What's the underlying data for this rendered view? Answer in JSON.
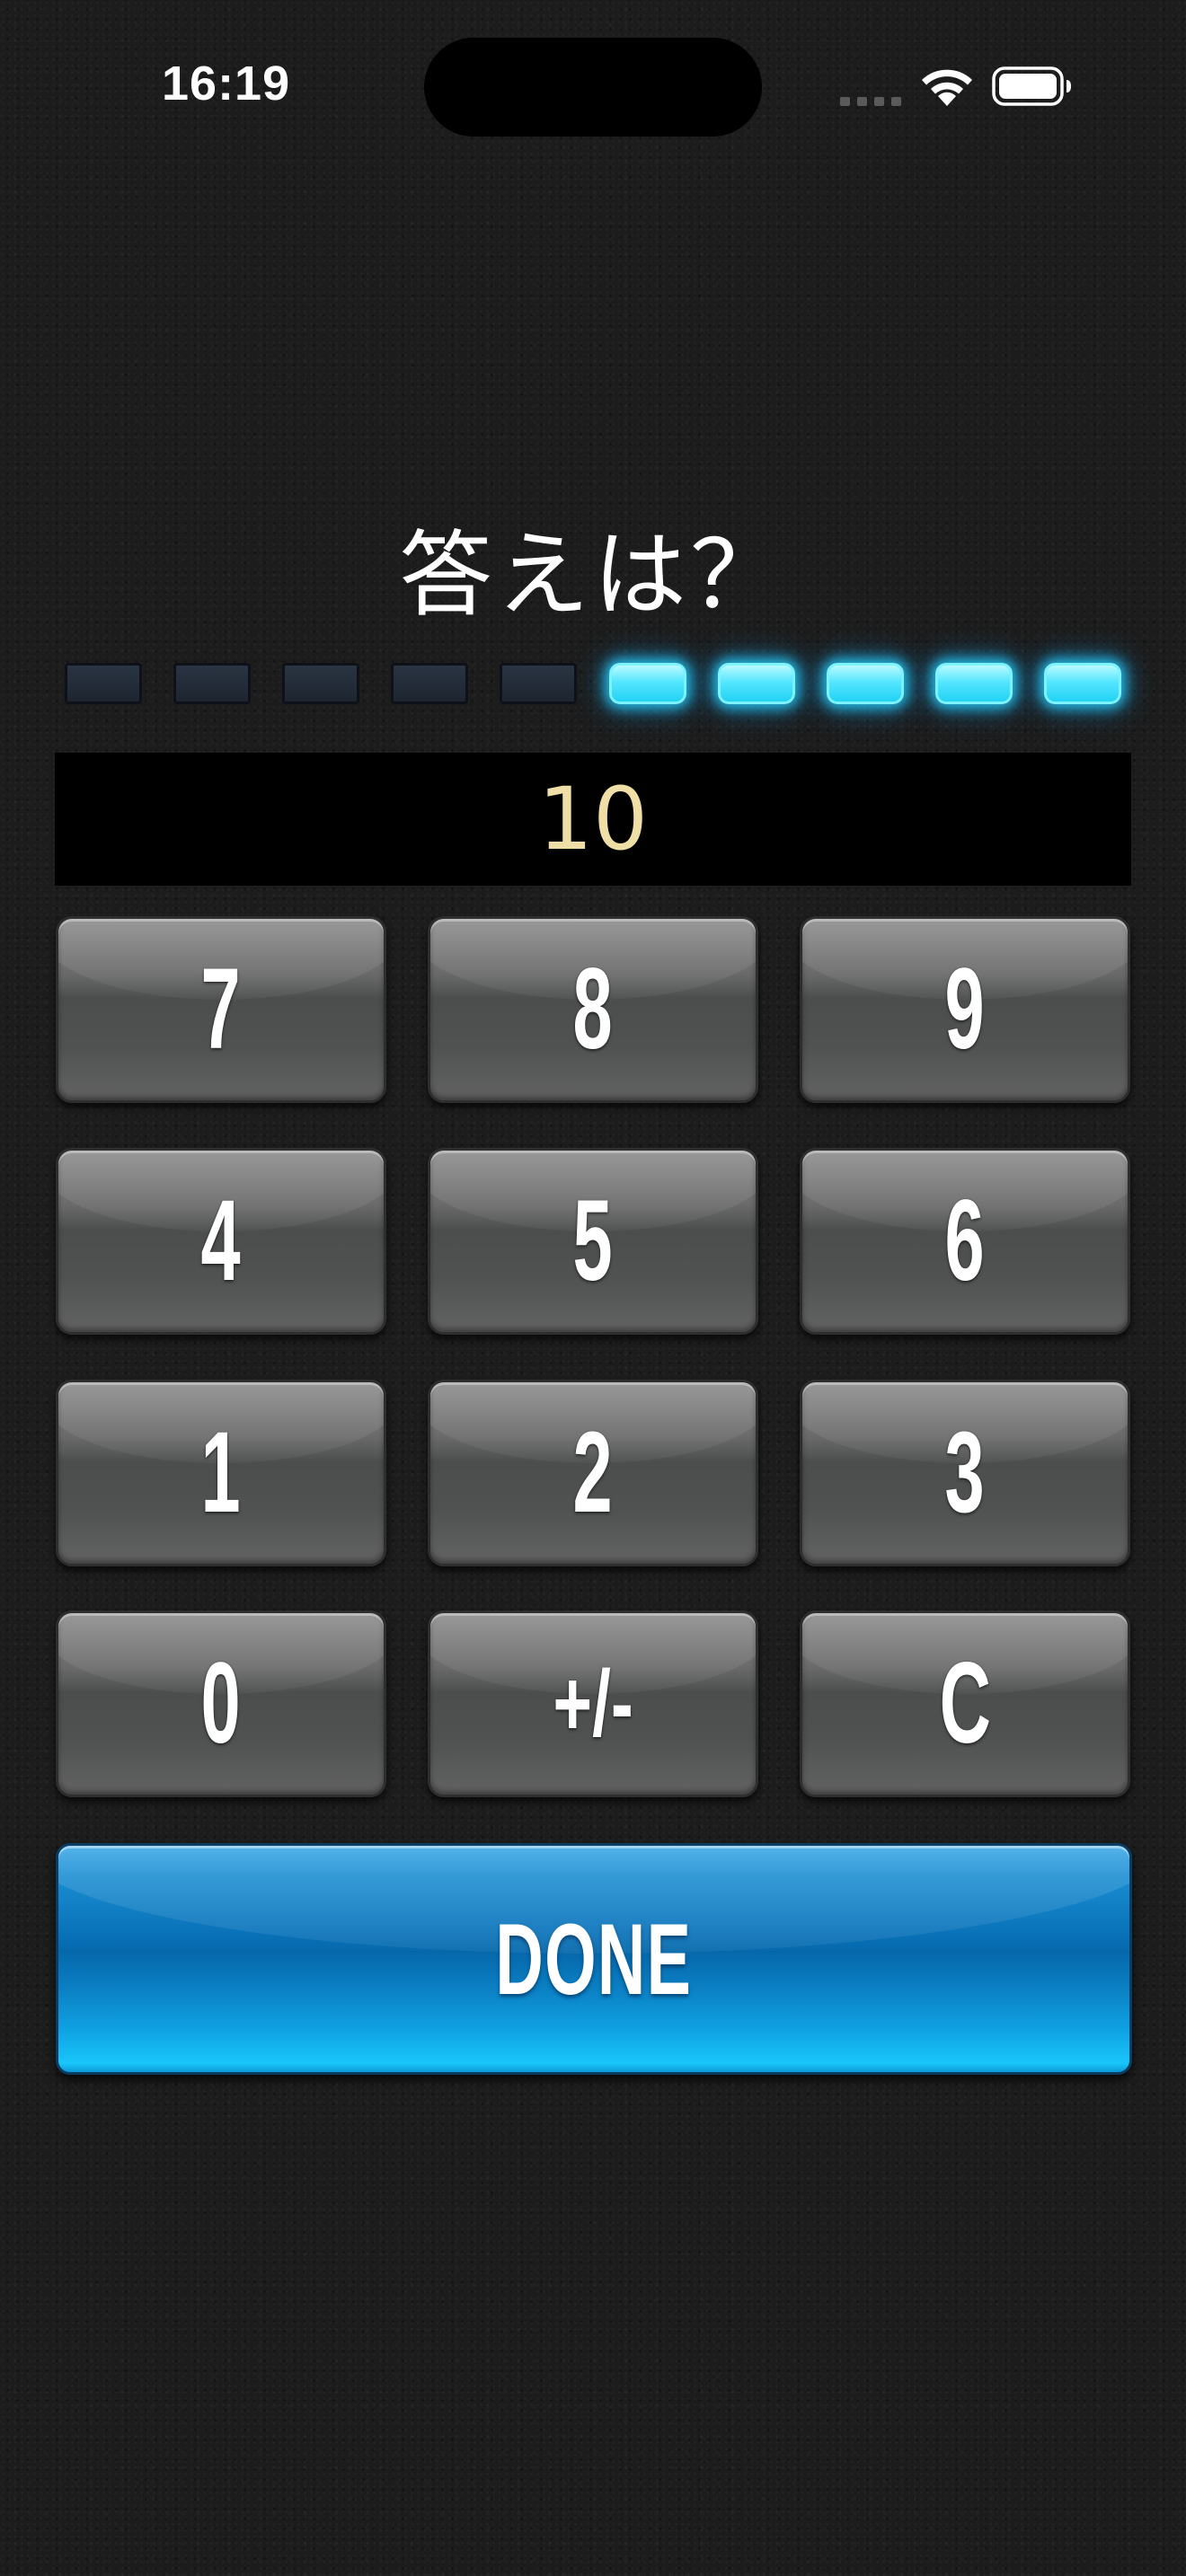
{
  "status_bar": {
    "time": "16:19",
    "icons": [
      "cellular-signal-icon",
      "wifi-icon",
      "battery-icon"
    ]
  },
  "question": {
    "title": "答えは？"
  },
  "progress": {
    "total_segments": 10,
    "lit_segments": 5,
    "lit_color": "#3fe0ff",
    "unlit_color": "#243040"
  },
  "answer": {
    "value": "10",
    "text_color": "#efdfa6"
  },
  "keypad": {
    "keys": [
      {
        "label": "7"
      },
      {
        "label": "8"
      },
      {
        "label": "9"
      },
      {
        "label": "4"
      },
      {
        "label": "5"
      },
      {
        "label": "6"
      },
      {
        "label": "1"
      },
      {
        "label": "2"
      },
      {
        "label": "3"
      },
      {
        "label": "0"
      },
      {
        "label": "+/-"
      },
      {
        "label": "C"
      }
    ]
  },
  "done_button": {
    "label": "DONE",
    "color": "#0a78c4"
  }
}
